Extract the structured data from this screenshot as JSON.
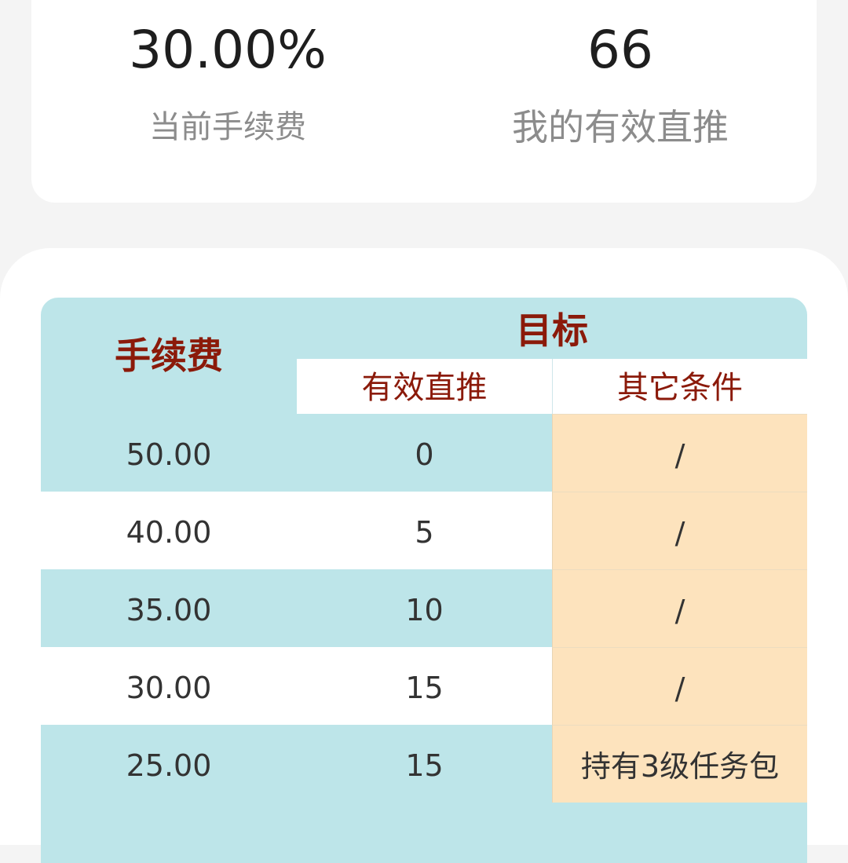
{
  "stats": {
    "fee_value": "30.00%",
    "fee_label": "当前手续费",
    "direct_value": "66",
    "direct_label": "我的有效直推"
  },
  "table": {
    "header_fee": "手续费",
    "header_target": "目标",
    "header_direct": "有效直推",
    "header_other": "其它条件",
    "rows": [
      {
        "fee": "50.00",
        "direct": "0",
        "other": "/"
      },
      {
        "fee": "40.00",
        "direct": "5",
        "other": "/"
      },
      {
        "fee": "35.00",
        "direct": "10",
        "other": "/"
      },
      {
        "fee": "30.00",
        "direct": "15",
        "other": "/"
      },
      {
        "fee": "25.00",
        "direct": "15",
        "other": "持有3级任务包"
      }
    ]
  },
  "colors": {
    "teal_row": "#bde5e9",
    "header_text": "#8b1a0a",
    "condition_cell": "#fde3bd",
    "page_background": "#f4f4f4"
  }
}
